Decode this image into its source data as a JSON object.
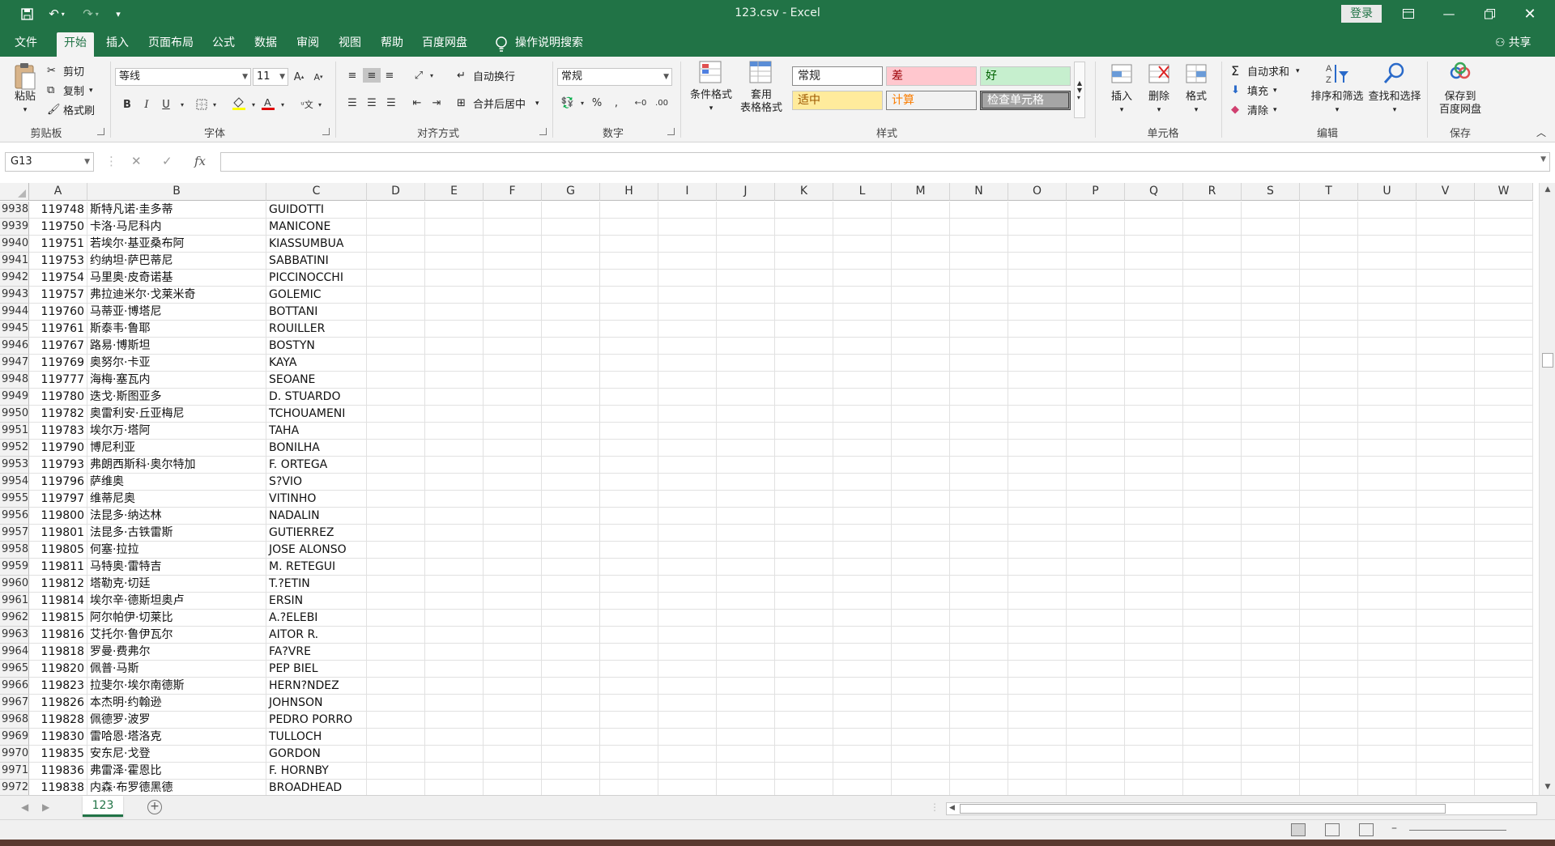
{
  "titlebar": {
    "title": "123.csv  -  Excel",
    "login": "登录"
  },
  "tabs": [
    "文件",
    "开始",
    "插入",
    "页面布局",
    "公式",
    "数据",
    "审阅",
    "视图",
    "帮助",
    "百度网盘"
  ],
  "active_tab": "开始",
  "tell_me": "操作说明搜索",
  "share": "共享",
  "ribbon": {
    "clipboard": {
      "label": "剪贴板",
      "paste": "粘贴",
      "cut": "剪切",
      "copy": "复制",
      "format_painter": "格式刷"
    },
    "font": {
      "label": "字体",
      "name": "等线",
      "size": "11",
      "bold": "B",
      "italic": "I",
      "underline": "U"
    },
    "alignment": {
      "label": "对齐方式",
      "wrap": "自动换行",
      "merge": "合并后居中"
    },
    "number": {
      "label": "数字",
      "format": "常规"
    },
    "styles": {
      "label": "样式",
      "conditional": "条件格式",
      "table_format_1": "套用",
      "table_format_2": "表格格式",
      "normal": "常规",
      "bad": "差",
      "good": "好",
      "neutral": "适中",
      "calc": "计算",
      "check": "检查单元格"
    },
    "cells": {
      "label": "单元格",
      "insert": "插入",
      "delete": "删除",
      "format": "格式"
    },
    "editing": {
      "label": "编辑",
      "autosum": "自动求和",
      "fill": "填充",
      "clear": "清除",
      "sort": "排序和筛选",
      "find": "查找和选择"
    },
    "save": {
      "label": "保存",
      "save_to_1": "保存到",
      "save_to_2": "百度网盘"
    }
  },
  "namebox": "G13",
  "fx": "fx",
  "columns": [
    "A",
    "B",
    "C",
    "D",
    "E",
    "F",
    "G",
    "H",
    "I",
    "J",
    "K",
    "L",
    "M",
    "N",
    "O",
    "P",
    "Q",
    "R",
    "S",
    "T",
    "U",
    "V",
    "W"
  ],
  "rows": [
    {
      "n": "9938",
      "a": "119748",
      "b": "斯特凡诺·圭多蒂",
      "c": "GUIDOTTI"
    },
    {
      "n": "9939",
      "a": "119750",
      "b": "卡洛·马尼科内",
      "c": "MANICONE"
    },
    {
      "n": "9940",
      "a": "119751",
      "b": "若埃尔·基亚桑布阿",
      "c": "KIASSUMBUA"
    },
    {
      "n": "9941",
      "a": "119753",
      "b": "约纳坦·萨巴蒂尼",
      "c": "SABBATINI"
    },
    {
      "n": "9942",
      "a": "119754",
      "b": "马里奥·皮奇诺基",
      "c": "PICCINOCCHI"
    },
    {
      "n": "9943",
      "a": "119757",
      "b": "弗拉迪米尔·戈莱米奇",
      "c": "GOLEMIC"
    },
    {
      "n": "9944",
      "a": "119760",
      "b": "马蒂亚·博塔尼",
      "c": "BOTTANI"
    },
    {
      "n": "9945",
      "a": "119761",
      "b": "斯泰韦·鲁耶",
      "c": "ROUILLER"
    },
    {
      "n": "9946",
      "a": "119767",
      "b": "路易·博斯坦",
      "c": "BOSTYN"
    },
    {
      "n": "9947",
      "a": "119769",
      "b": "奥努尔·卡亚",
      "c": "KAYA"
    },
    {
      "n": "9948",
      "a": "119777",
      "b": "海梅·塞瓦内",
      "c": "SEOANE"
    },
    {
      "n": "9949",
      "a": "119780",
      "b": "迭戈·斯图亚多",
      "c": "D. STUARDO"
    },
    {
      "n": "9950",
      "a": "119782",
      "b": "奥雷利安·丘亚梅尼",
      "c": "TCHOUAMENI"
    },
    {
      "n": "9951",
      "a": "119783",
      "b": "埃尔万·塔阿",
      "c": "TAHA"
    },
    {
      "n": "9952",
      "a": "119790",
      "b": "博尼利亚",
      "c": "BONILHA"
    },
    {
      "n": "9953",
      "a": "119793",
      "b": "弗朗西斯科·奥尔特加",
      "c": "F. ORTEGA"
    },
    {
      "n": "9954",
      "a": "119796",
      "b": "萨维奥",
      "c": "S?VIO"
    },
    {
      "n": "9955",
      "a": "119797",
      "b": "维蒂尼奥",
      "c": "VITINHO"
    },
    {
      "n": "9956",
      "a": "119800",
      "b": "法昆多·纳达林",
      "c": "NADALIN"
    },
    {
      "n": "9957",
      "a": "119801",
      "b": "法昆多·古铁雷斯",
      "c": "GUTIERREZ"
    },
    {
      "n": "9958",
      "a": "119805",
      "b": "何塞·拉拉",
      "c": "JOSE ALONSO"
    },
    {
      "n": "9959",
      "a": "119811",
      "b": "马特奥·雷特吉",
      "c": "M. RETEGUI"
    },
    {
      "n": "9960",
      "a": "119812",
      "b": "塔勒克·切廷",
      "c": "T.?ETIN"
    },
    {
      "n": "9961",
      "a": "119814",
      "b": "埃尔辛·德斯坦奥卢",
      "c": "ERSIN"
    },
    {
      "n": "9962",
      "a": "119815",
      "b": "阿尔帕伊·切莱比",
      "c": "A.?ELEBI"
    },
    {
      "n": "9963",
      "a": "119816",
      "b": "艾托尔·鲁伊瓦尔",
      "c": "AITOR R."
    },
    {
      "n": "9964",
      "a": "119818",
      "b": "罗曼·费弗尔",
      "c": "FA?VRE"
    },
    {
      "n": "9965",
      "a": "119820",
      "b": "佩普·马斯",
      "c": "PEP BIEL"
    },
    {
      "n": "9966",
      "a": "119823",
      "b": "拉斐尔·埃尔南德斯",
      "c": "HERN?NDEZ"
    },
    {
      "n": "9967",
      "a": "119826",
      "b": "本杰明·约翰逊",
      "c": "JOHNSON"
    },
    {
      "n": "9968",
      "a": "119828",
      "b": "佩德罗·波罗",
      "c": "PEDRO PORRO"
    },
    {
      "n": "9969",
      "a": "119830",
      "b": "雷哈恩·塔洛克",
      "c": "TULLOCH"
    },
    {
      "n": "9970",
      "a": "119835",
      "b": "安东尼·戈登",
      "c": "GORDON"
    },
    {
      "n": "9971",
      "a": "119836",
      "b": "弗雷泽·霍恩比",
      "c": "F. HORNBY"
    },
    {
      "n": "9972",
      "a": "119838",
      "b": "内森·布罗德黑德",
      "c": "BROADHEAD"
    }
  ],
  "sheet_tab": "123",
  "colors": {
    "brand": "#217346",
    "bad_bg": "#ffc7ce",
    "good_bg": "#c6efce",
    "neutral_bg": "#ffeb9c",
    "calc_bg": "#f2f2f2",
    "check_bg": "#a5a5a5"
  }
}
